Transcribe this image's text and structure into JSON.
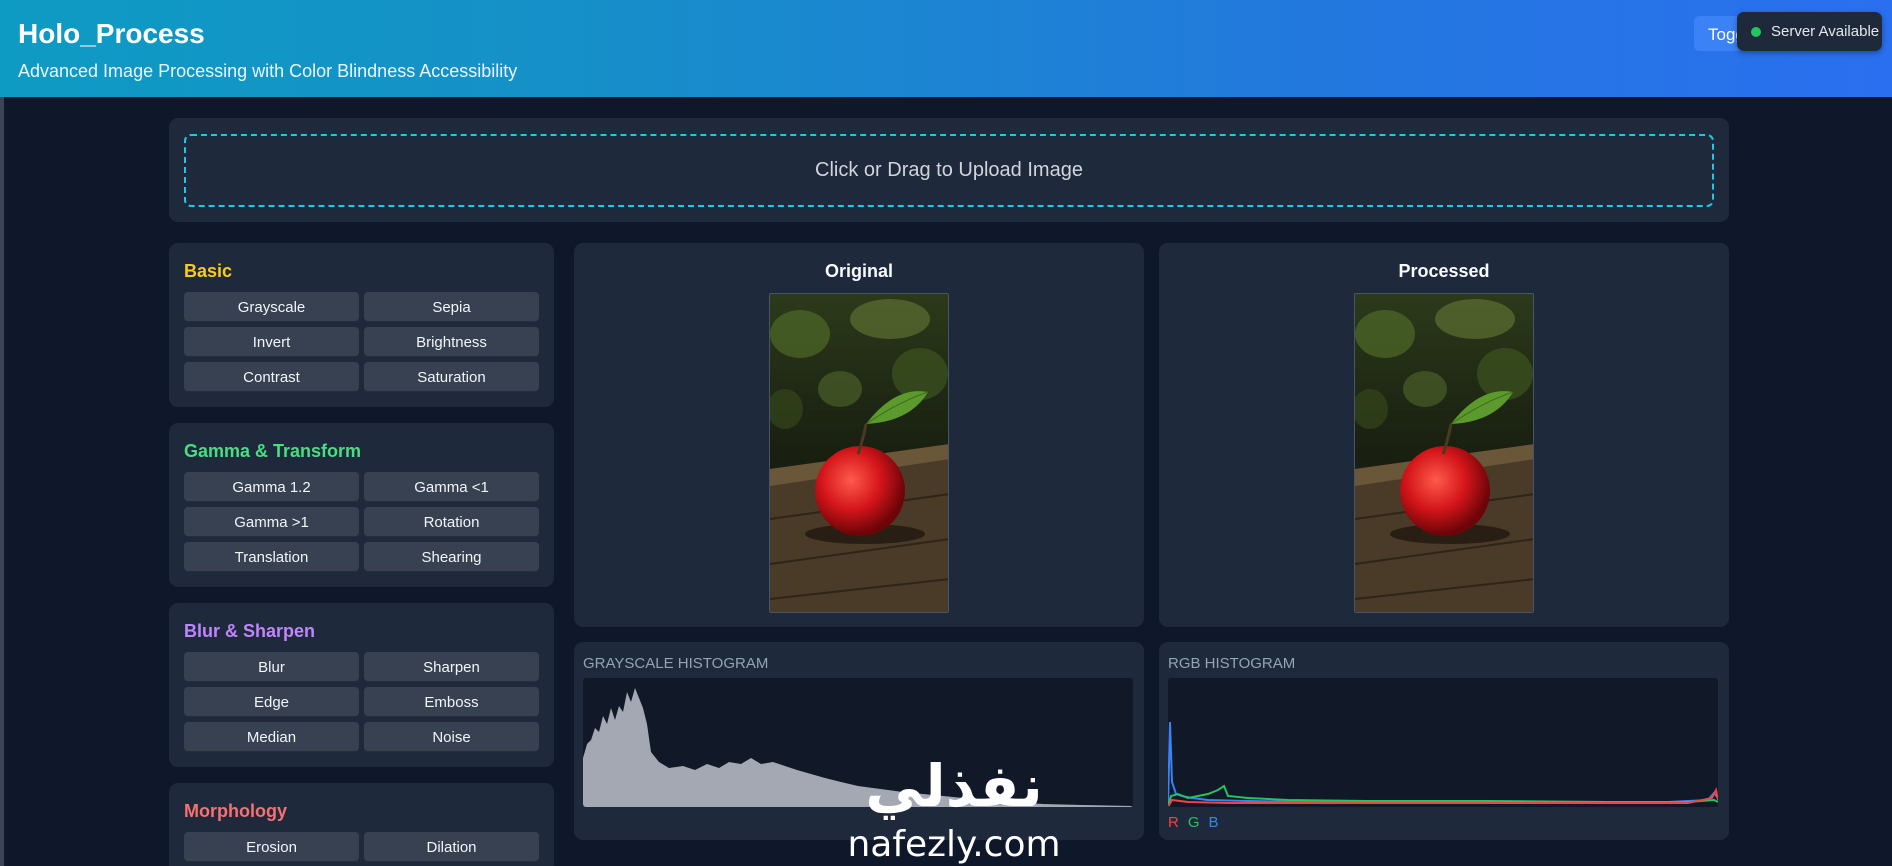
{
  "header": {
    "title": "Holo_Process",
    "subtitle": "Advanced Image Processing with Color Blindness Accessibility",
    "toggle_label": "Toggle",
    "server_status": "Server Available",
    "status_color": "#22c55e"
  },
  "upload": {
    "label": "Click or Drag to Upload Image"
  },
  "sidebar": {
    "sections": [
      {
        "title": "Basic",
        "color": "#facc15",
        "buttons": [
          "Grayscale",
          "Sepia",
          "Invert",
          "Brightness",
          "Contrast",
          "Saturation"
        ]
      },
      {
        "title": "Gamma & Transform",
        "color": "#4ade80",
        "buttons": [
          "Gamma 1.2",
          "Gamma <1",
          "Gamma >1",
          "Rotation",
          "Translation",
          "Shearing"
        ]
      },
      {
        "title": "Blur & Sharpen",
        "color": "#c084fc",
        "buttons": [
          "Blur",
          "Sharpen",
          "Edge",
          "Emboss",
          "Median",
          "Noise"
        ]
      },
      {
        "title": "Morphology",
        "color": "#f87171",
        "buttons": [
          "Erosion",
          "Dilation"
        ]
      }
    ]
  },
  "viewer": {
    "original_title": "Original",
    "processed_title": "Processed"
  },
  "histograms": {
    "grayscale_title": "GRAYSCALE HISTOGRAM",
    "rgb_title": "RGB HISTOGRAM",
    "legend": [
      {
        "label": "R",
        "color": "#ef4444"
      },
      {
        "label": "G",
        "color": "#22c55e"
      },
      {
        "label": "B",
        "color": "#3b82f6"
      }
    ]
  },
  "watermark": {
    "arabic": "نفذلي",
    "latin": "nafezly.com"
  }
}
